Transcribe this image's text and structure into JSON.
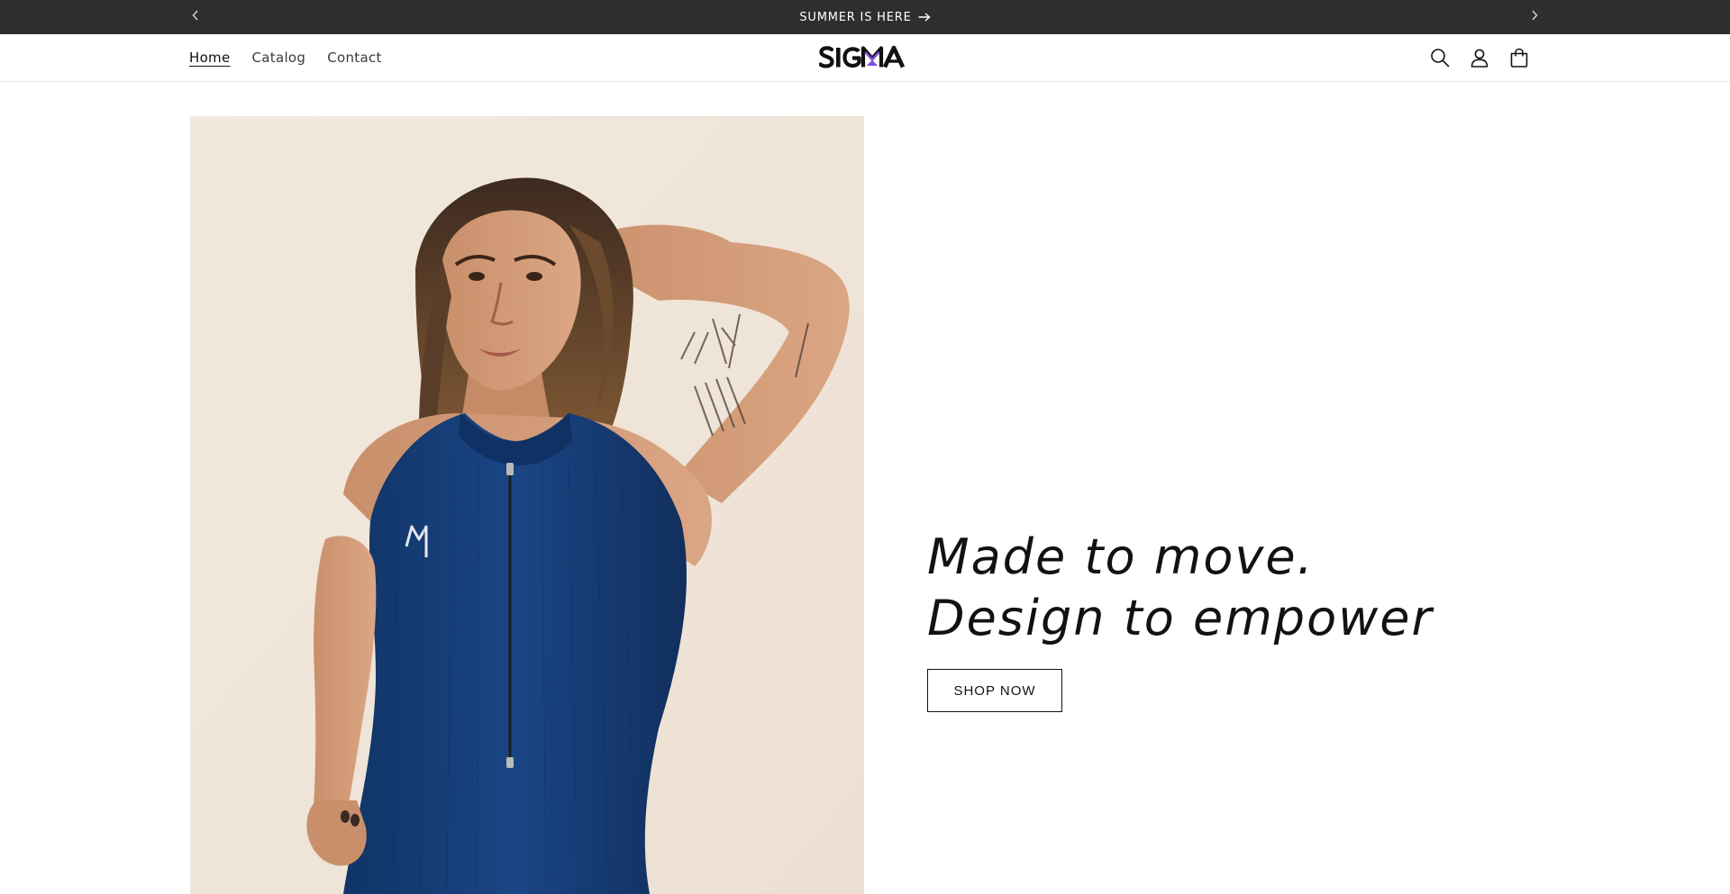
{
  "announcement": {
    "text": "SUMMER IS HERE",
    "prev_icon": "chevron-left-icon",
    "next_icon": "chevron-right-icon",
    "arrow_icon": "arrow-right-icon",
    "background": "#2e2e2e"
  },
  "header": {
    "nav": [
      {
        "label": "Home",
        "active": true
      },
      {
        "label": "Catalog",
        "active": false
      },
      {
        "label": "Contact",
        "active": false
      }
    ],
    "logo_text": "SIGMA",
    "logo_accent": "#7b4fe0",
    "icons": [
      "search-icon",
      "account-icon",
      "cart-icon"
    ]
  },
  "hero": {
    "heading": "Made to move. Design to empower",
    "button_label": "SHOP NOW",
    "image_description_icon": "model-photo",
    "colors": {
      "image_bg": "#efe6dc",
      "garment": "#163e78"
    }
  }
}
